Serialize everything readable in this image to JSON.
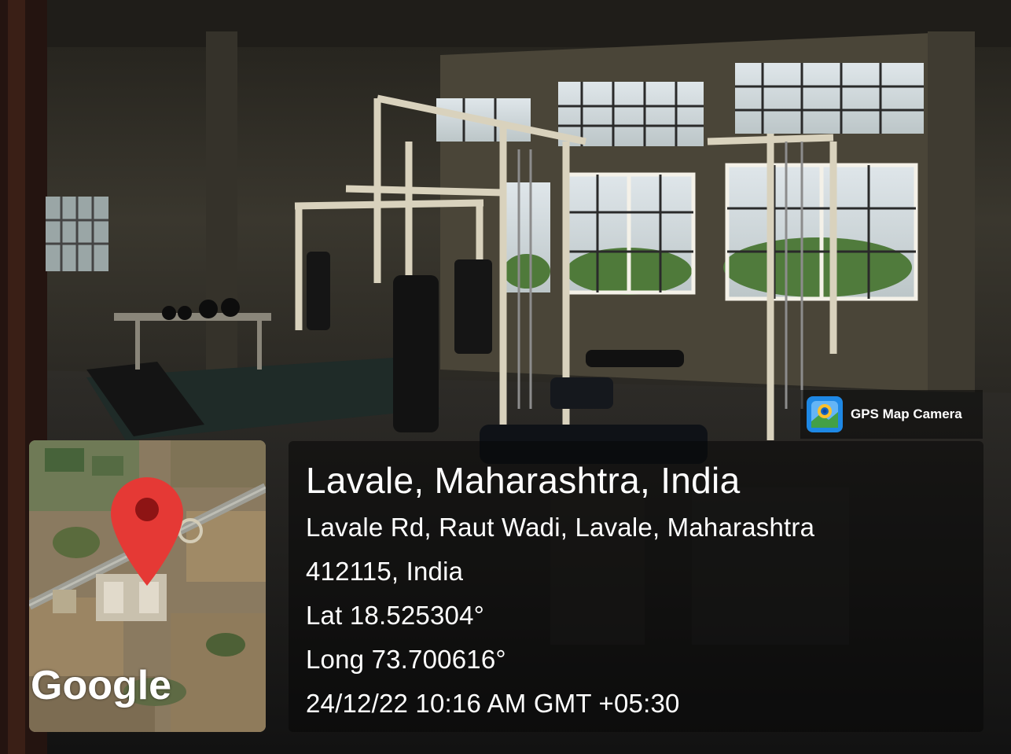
{
  "badge": {
    "label": "GPS Map Camera",
    "icon": "gps-map-camera-icon"
  },
  "map": {
    "wordmark": "Google",
    "pin_icon": "map-pin-icon",
    "pin_color": "#e53935"
  },
  "info": {
    "title": "Lavale, Maharashtra, India",
    "address_line_1": "Lavale Rd, Raut Wadi, Lavale, Maharashtra",
    "address_line_2": "412115, India",
    "latitude": "Lat 18.525304°",
    "longitude": "Long 73.700616°",
    "timestamp": "24/12/22 10:16 AM GMT +05:30"
  }
}
